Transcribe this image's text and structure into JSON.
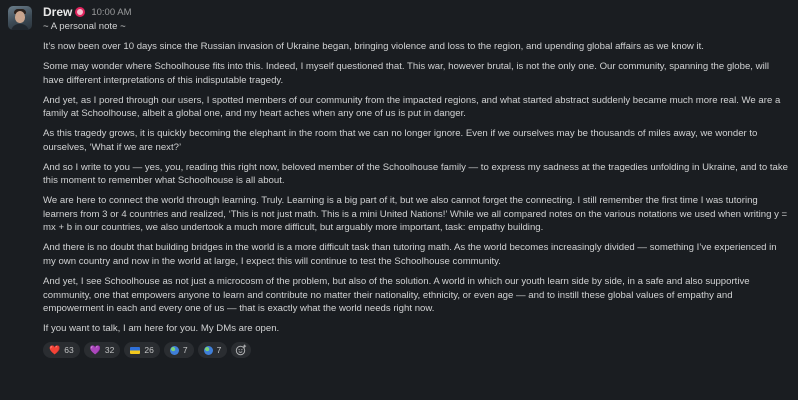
{
  "message": {
    "author": "Drew",
    "timestamp": "10:00 AM",
    "paragraphs": [
      "~ A personal note ~",
      "It’s now been over 10 days since the Russian invasion of Ukraine began, bringing violence and loss to the region, and upending global affairs as we know it.",
      "Some may wonder where Schoolhouse fits into this. Indeed, I myself questioned that. This war, however brutal, is not the only one. Our community, spanning the globe, will have different interpretations of this indisputable tragedy.",
      "And yet, as I pored through our users, I spotted members of our community from the impacted regions, and what started abstract suddenly became much more real. We are a family at Schoolhouse, albeit a global one, and my heart aches when any one of us is put in danger.",
      "As this tragedy grows, it is quickly becoming the elephant in the room that we can no longer ignore. Even if we ourselves may be thousands of miles away, we wonder to ourselves, ‘What if we are next?’",
      "And so I write to you — yes, you, reading this right now, beloved member of the Schoolhouse family — to express my sadness at the tragedies unfolding in Ukraine, and to take this moment to remember what Schoolhouse is all about.",
      "We are here to connect the world through learning. Truly. Learning is a big part of it, but we also cannot forget the connecting. I still remember the first time I was tutoring learners from 3 or 4 countries and realized, ‘This is not just math. This is a mini United Nations!’ While we all compared notes on the various notations we used when writing y = mx + b in our countries, we also undertook a much more difficult, but arguably more important, task: empathy building.",
      "And there is no doubt that building bridges in the world is a more difficult task than tutoring math. As the world becomes increasingly divided — something I’ve experienced in my own country and now in the world at large, I expect this will continue to test the Schoolhouse community.",
      "And yet, I see Schoolhouse as not just a microcosm of the problem, but also of the solution. A world in which our youth learn side by side, in a safe and also supportive community, one that empowers anyone to learn and contribute no matter their nationality, ethnicity, or even age — and to instill these global values of empathy and empowerment in each and every one of us — that is exactly what the world needs right now.",
      "If you want to talk, I am here for you. My DMs are open."
    ]
  },
  "reactions": [
    {
      "icon": "red-heart-icon",
      "glyph": "❤️",
      "count": "63"
    },
    {
      "icon": "purple-heart-icon",
      "glyph": "💜",
      "count": "32"
    },
    {
      "icon": "ukraine-flag-icon",
      "glyph": "",
      "count": "26"
    },
    {
      "icon": "globe-icon",
      "glyph": "",
      "count": "7"
    },
    {
      "icon": "globe-asia-icon",
      "glyph": "",
      "count": "7"
    }
  ],
  "colors": {
    "background": "#1a1d21",
    "text": "#d1d2d3",
    "reaction_bg": "#2a2d31"
  }
}
